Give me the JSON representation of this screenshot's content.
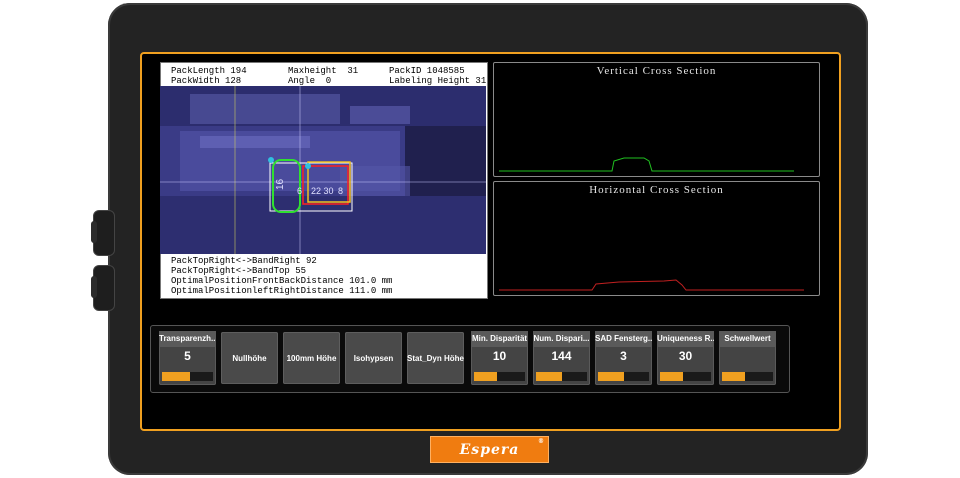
{
  "device": {
    "logo_text": "Espera",
    "logo_mark": "®",
    "colors": {
      "accent": "#f0a020",
      "bezel": "#232323",
      "logo": "#f07c10"
    }
  },
  "camera_panel": {
    "top_info": {
      "pack_length": "PackLength 194",
      "pack_width": "PackWidth 128",
      "max_height": "Maxheight  31",
      "angle": "Angle  0",
      "pack_id": "PackID 1048585",
      "labeling_height": "Labeling Height 31"
    },
    "bottom_info": [
      "PackTopRight<->BandRight 92",
      "PackTopRight<->BandTop 55",
      "OptimalPositionFrontBackDistance 101.0 mm",
      "OptimalPositionleftRightDistance 111.0 mm"
    ],
    "overlay_labels": {
      "green_a": "16",
      "green_b": "6",
      "red": "22 30",
      "orange": "8"
    }
  },
  "graphs": {
    "vertical_title": "Vertical Cross Section",
    "horizontal_title": "Horizontal Cross Section"
  },
  "controls": {
    "sliders": [
      {
        "label": "Transparenzh...",
        "value": "5",
        "level": 0.55
      },
      {
        "label": "Min. Disparität",
        "value": "10",
        "level": 0.45
      },
      {
        "label": "Num. Dispari...",
        "value": "144",
        "level": 0.5
      },
      {
        "label": "SAD Fensterg...",
        "value": "3",
        "level": 0.5
      },
      {
        "label": "Uniqueness R...",
        "value": "30",
        "level": 0.45
      },
      {
        "label": "Schwellwert",
        "value": "",
        "level": 0.45
      }
    ],
    "buttons": [
      "Nullhöhe",
      "100mm Höhe",
      "Isohypsen",
      "Stat_Dyn Höhe"
    ]
  }
}
